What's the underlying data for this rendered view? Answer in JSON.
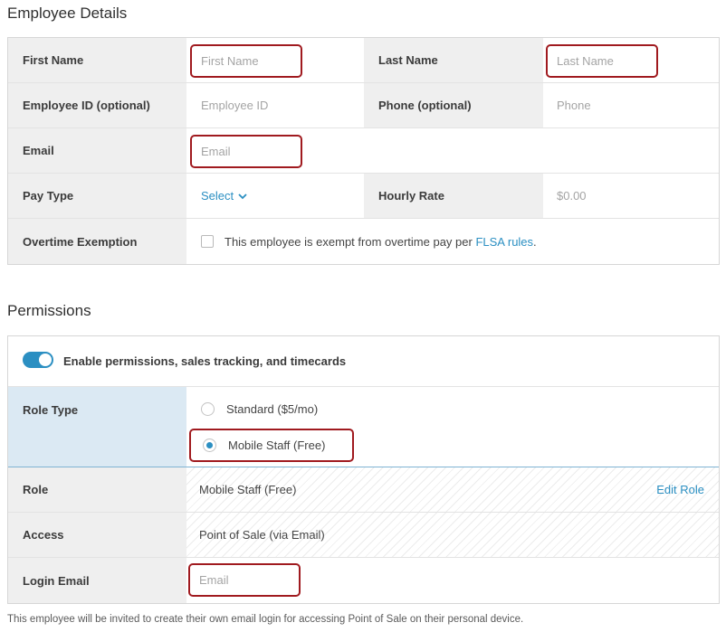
{
  "employee_details": {
    "heading": "Employee Details",
    "first_name": {
      "label": "First Name",
      "placeholder": "First Name"
    },
    "last_name": {
      "label": "Last Name",
      "placeholder": "Last Name"
    },
    "employee_id": {
      "label": "Employee ID (optional)",
      "placeholder": "Employee ID"
    },
    "phone": {
      "label": "Phone (optional)",
      "placeholder": "Phone"
    },
    "email": {
      "label": "Email",
      "placeholder": "Email"
    },
    "pay_type": {
      "label": "Pay Type",
      "value": "Select"
    },
    "hourly_rate": {
      "label": "Hourly Rate",
      "placeholder": "$0.00"
    },
    "overtime": {
      "label": "Overtime Exemption",
      "text": "This employee is exempt from overtime pay per",
      "link": "FLSA rules",
      "suffix": "."
    }
  },
  "permissions": {
    "heading": "Permissions",
    "toggle_label": "Enable permissions, sales tracking, and timecards",
    "role_type": {
      "label": "Role Type",
      "options": [
        "Standard ($5/mo)",
        "Mobile Staff (Free)"
      ],
      "selected": "Mobile Staff (Free)"
    },
    "role": {
      "label": "Role",
      "value": "Mobile Staff (Free)",
      "action": "Edit Role"
    },
    "access": {
      "label": "Access",
      "value": "Point of Sale (via Email)"
    },
    "login_email": {
      "label": "Login Email",
      "placeholder": "Email"
    }
  },
  "footnote": "This employee will be invited to create their own email login for accessing Point of Sale on their personal device.",
  "colors": {
    "accent": "#2b8fc2",
    "highlight_border": "#a01a1f",
    "label_bg": "#efefef",
    "role_type_bg": "#dbe9f3"
  }
}
